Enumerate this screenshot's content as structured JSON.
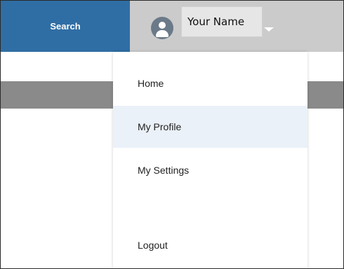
{
  "header": {
    "search_label": "Search",
    "user_name": "Your Name",
    "avatar_icon": "user-avatar-icon",
    "dropdown_icon": "chevron-down-icon"
  },
  "menu": {
    "items": [
      {
        "label": "Home",
        "active": false
      },
      {
        "label": "My Profile",
        "active": true
      },
      {
        "label": "My Settings",
        "active": false
      },
      {
        "label": "Logout",
        "active": false
      }
    ]
  },
  "colors": {
    "search_bg": "#2f6ea4",
    "topbar_bg": "#cbcbcb",
    "active_item_bg": "#eaf1f8",
    "avatar_bg": "#6b7a89"
  }
}
